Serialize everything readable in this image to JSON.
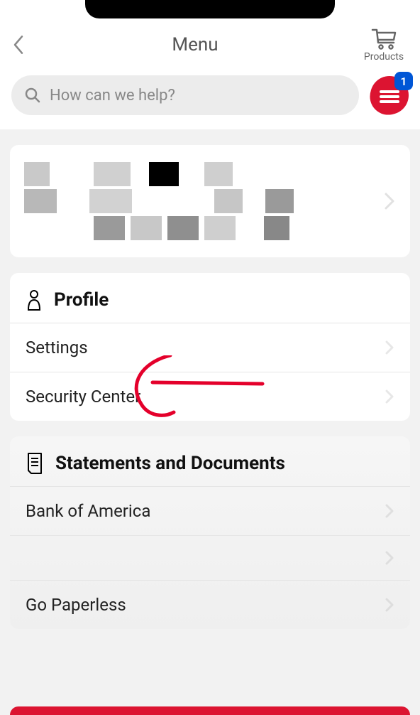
{
  "header": {
    "title": "Menu",
    "products_label": "Products"
  },
  "search": {
    "placeholder": "How can we help?"
  },
  "chat_badge": "1",
  "profile_section": {
    "title": "Profile",
    "items": [
      {
        "label": "Settings"
      },
      {
        "label": "Security Center"
      }
    ]
  },
  "statements_section": {
    "title": "Statements and Documents",
    "items": [
      {
        "label": "Bank of America"
      },
      {
        "label": ""
      },
      {
        "label": "Go Paperless"
      }
    ]
  }
}
